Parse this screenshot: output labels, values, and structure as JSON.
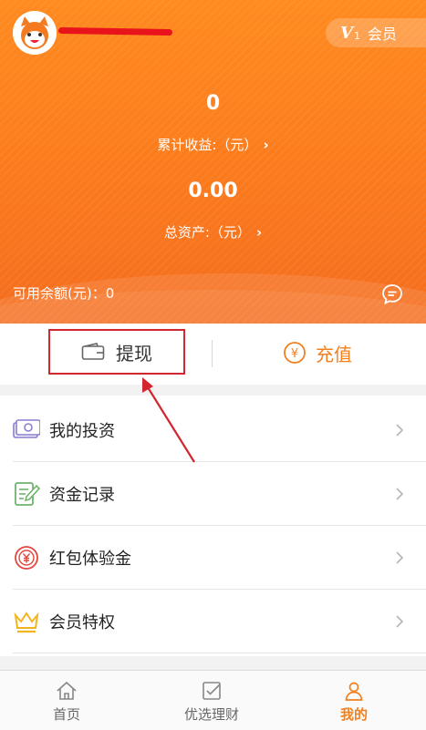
{
  "header": {
    "member_badge": {
      "v_mark": "V",
      "level": "1",
      "label": "会员"
    },
    "cumulative_earnings": {
      "value": "0",
      "label": "累计收益:（元）"
    },
    "total_assets": {
      "value": "0.00",
      "label": "总资产:（元）"
    },
    "available_balance": "可用余额(元)：0"
  },
  "actions": {
    "withdraw_label": "提现",
    "recharge_label": "充值",
    "recharge_symbol": "¥"
  },
  "menu": {
    "items": [
      {
        "label": "我的投资",
        "icon": "money-icon"
      },
      {
        "label": "资金记录",
        "icon": "document-edit-icon"
      },
      {
        "label": "红包体验金",
        "icon": "red-packet-icon"
      },
      {
        "label": "会员特权",
        "icon": "crown-icon"
      }
    ]
  },
  "bottom_nav": {
    "items": [
      {
        "label": "首页",
        "icon": "home-icon",
        "active": false
      },
      {
        "label": "优选理财",
        "icon": "checklist-icon",
        "active": false
      },
      {
        "label": "我的",
        "icon": "user-icon",
        "active": true
      }
    ]
  },
  "colors": {
    "brand_orange": "#f98020",
    "highlight_red": "#d22630"
  }
}
